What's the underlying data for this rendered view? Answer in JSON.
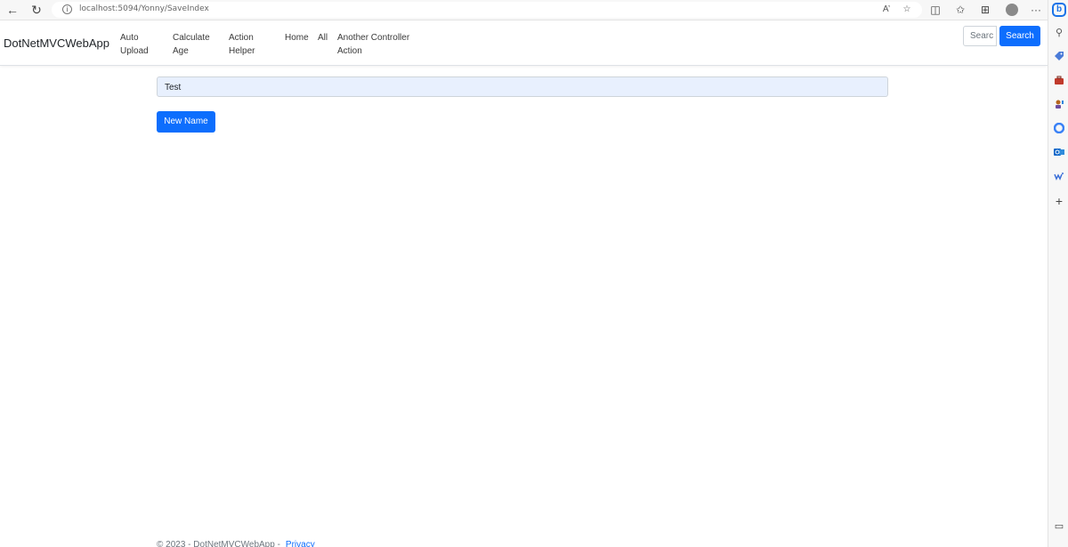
{
  "browser": {
    "url": "localhost:5094/Yonny/SaveIndex",
    "back_glyph": "←",
    "refresh_glyph": "↻",
    "info_glyph": "i",
    "read_aloud_label": "A’",
    "favorite_glyph": "☆",
    "split_glyph": "◫",
    "favorites_glyph": "✩",
    "collections_glyph": "⊞",
    "more_glyph": "···",
    "icons": [
      "back-arrow-icon",
      "refresh-icon",
      "info-icon",
      "read-aloud-icon",
      "favorite-star-icon",
      "split-screen-icon",
      "favorites-list-icon",
      "collections-icon",
      "profile-avatar-icon",
      "more-menu-icon"
    ]
  },
  "sidebar": {
    "bing_glyph": "b",
    "search_glyph": "⚲",
    "add_glyph": "+",
    "bottom_glyph": "▭",
    "icons": [
      "bing-copilot-icon",
      "search-icon",
      "shopping-tag-icon",
      "tools-briefcase-icon",
      "games-icon",
      "microsoft-365-icon",
      "outlook-icon",
      "drop-icon",
      "add-icon",
      "sidebar-toggle-icon"
    ]
  },
  "navbar": {
    "brand": "DotNetMVCWebApp",
    "links": [
      {
        "line1": "Auto",
        "line2": "Upload"
      },
      {
        "line1": "Calculate",
        "line2": "Age"
      },
      {
        "line1": "Action",
        "line2": "Helper"
      },
      {
        "line1": "Home",
        "line2": ""
      },
      {
        "line1": "All",
        "line2": ""
      },
      {
        "line1": "Another Controller",
        "line2": "Action"
      }
    ],
    "search_value": "Searc",
    "search_button": "Search"
  },
  "main": {
    "name_value": "Test",
    "new_name_button": "New Name"
  },
  "footer": {
    "copyright": "© 2023 - DotNetMVCWebApp -",
    "privacy_link": "Privacy"
  },
  "colors": {
    "primary": "#0d6efd",
    "autofill_bg": "#e8f0fe",
    "chrome_bg": "#f7f7f7"
  }
}
